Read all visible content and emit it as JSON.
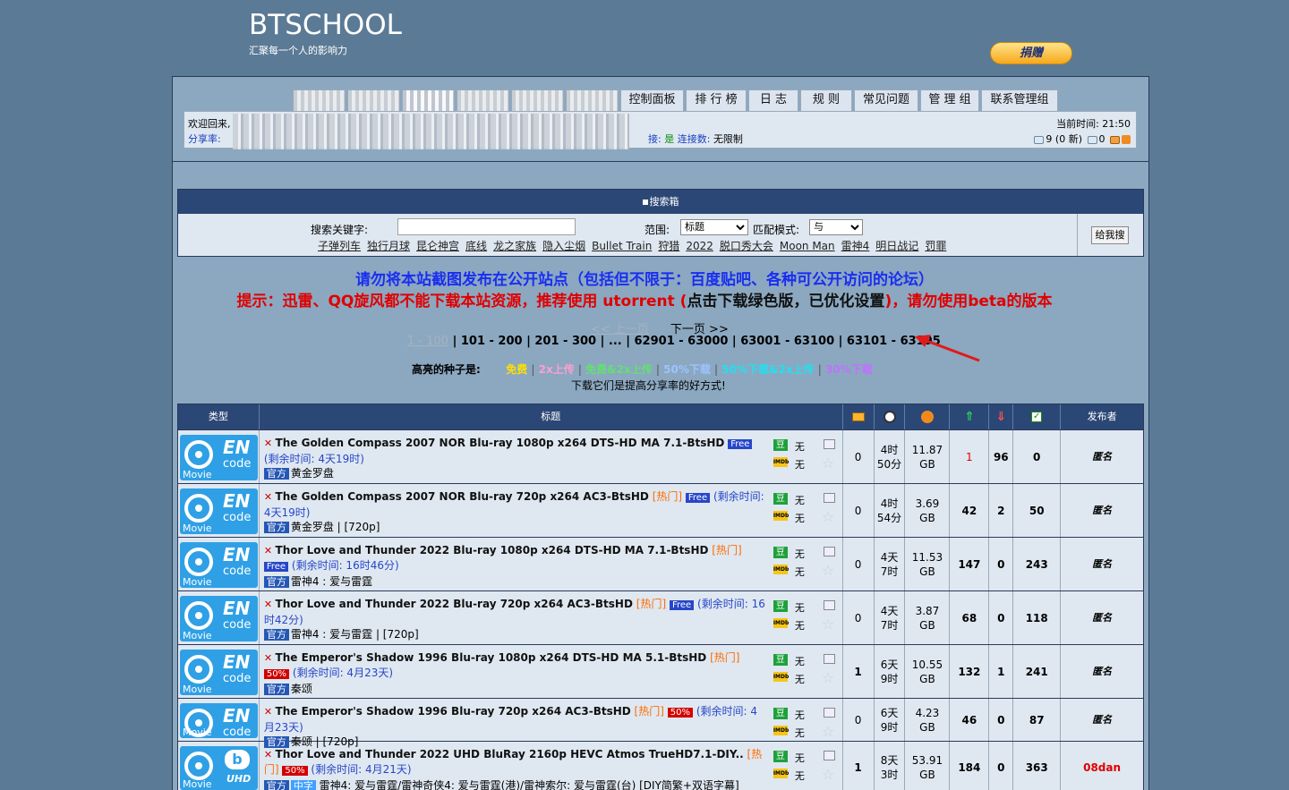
{
  "site": {
    "logo": "BTSCHOOL",
    "slogan": "汇聚每一个人的影响力",
    "donate": "捐赠"
  },
  "nav": {
    "blurred_tab_count": 6,
    "tabs": [
      "控制面板",
      "排 行 榜",
      "日 志",
      "规 则",
      "常见问题",
      "管 理 组",
      "联系管理组"
    ]
  },
  "userbar": {
    "welcome": "欢迎回来,",
    "share_ratio": "分享率:",
    "connect_label": "接:",
    "connect_yes": "是",
    "connections": "连接数:",
    "connections_val": "无限制",
    "time_label": "当前时间:",
    "time": "21:50",
    "messages": "9 (0 新)",
    "unread": "0"
  },
  "search": {
    "header": "搜索箱",
    "keyword_label": "搜索关键字:",
    "keyword_value": "",
    "scope_label": "范围:",
    "scope_value": "标题",
    "mode_label": "匹配模式:",
    "mode_value": "与",
    "button": "给我搜",
    "hot": [
      "子弹列车",
      "独行月球",
      "昆仑神宫",
      "底线",
      "龙之家族",
      "隐入尘烟",
      "Bullet Train",
      "狩猎",
      "2022",
      "脱口秀大会",
      "Moon Man",
      "雷神4",
      "明日战记",
      "罚罪"
    ]
  },
  "notices": {
    "line1": "请勿将本站截图发布在公开站点（包括但不限于：百度贴吧、各种可公开访问的论坛）",
    "line2a": "提示：迅雷、QQ旋风都不能下载本站资源，推荐使用 utorrent (",
    "line2b": "点击下载绿色版，已优化设置",
    "line2c": ")，请勿使用beta的版本"
  },
  "pager": {
    "prev": "<< 上一页",
    "next": "下一页 >>",
    "current": "1 - 100",
    "pages": "| 101 - 200 | 201 - 300 | ... | 62901 - 63000 | 63001 - 63100 | 63101 - 63195"
  },
  "legend": {
    "label": "高亮的种子是:",
    "items": [
      "免费",
      "2x上传",
      "免费&2x上传",
      "50%下载",
      "50%下载&2x上传",
      "30%下载"
    ],
    "tip": "下载它们是提高分享率的好方式!"
  },
  "columns": {
    "type": "类型",
    "title": "标题",
    "uploader": "发布者"
  },
  "badges": {
    "douban": "豆",
    "imdb": "IMDb",
    "none": "无",
    "official": "官方",
    "chinese": "中字",
    "hot": "热门",
    "free": "Free",
    "half": "50%"
  },
  "torrents": [
    {
      "cat": "encode",
      "name": "The Golden Compass 2007 NOR Blu-ray 1080p x264 DTS-HD MA 7.1-BtsHD",
      "hot": false,
      "promo": "Free",
      "remain": "(剩余时间: 4天19时)",
      "sub": "黄金罗盘",
      "comments": "0",
      "time": "4时\n50分",
      "size": "11.87\nGB",
      "seeders": "1",
      "leechers": "96",
      "done": "0",
      "uploader": "匿名",
      "seed_red": true
    },
    {
      "cat": "encode",
      "name": "The Golden Compass 2007 NOR Blu-ray 720p x264 AC3-BtsHD",
      "hot": true,
      "promo": "Free",
      "remain": "(剩余时间: 4天19时)",
      "sub": "黄金罗盘 | [720p]",
      "comments": "0",
      "time": "4时\n54分",
      "size": "3.69\nGB",
      "seeders": "42",
      "leechers": "2",
      "done": "50",
      "uploader": "匿名",
      "seed_red": false
    },
    {
      "cat": "encode",
      "name": "Thor Love and Thunder 2022 Blu-ray 1080p x264 DTS-HD MA 7.1-BtsHD",
      "hot": true,
      "promo": "Free",
      "remain": "(剩余时间: 16时46分)",
      "sub": "雷神4 : 爱与雷霆",
      "comments": "0",
      "time": "4天\n7时",
      "size": "11.53\nGB",
      "seeders": "147",
      "leechers": "0",
      "done": "243",
      "uploader": "匿名",
      "seed_red": false
    },
    {
      "cat": "encode",
      "name": "Thor Love and Thunder 2022 Blu-ray 720p x264 AC3-BtsHD",
      "hot": true,
      "promo": "Free",
      "remain": "(剩余时间: 16时42分)",
      "sub": "雷神4 : 爱与雷霆 | [720p]",
      "comments": "0",
      "time": "4天\n7时",
      "size": "3.87\nGB",
      "seeders": "68",
      "leechers": "0",
      "done": "118",
      "uploader": "匿名",
      "seed_red": false
    },
    {
      "cat": "encode",
      "name": "The Emperor's Shadow 1996 Blu-ray 1080p x264 DTS-HD MA 5.1-BtsHD",
      "hot": true,
      "promo": "50%",
      "remain": "(剩余时间: 4月23天)",
      "sub": "秦颂",
      "comments": "1",
      "time": "6天\n9时",
      "size": "10.55\nGB",
      "seeders": "132",
      "leechers": "1",
      "done": "241",
      "uploader": "匿名",
      "seed_red": false
    },
    {
      "cat": "encode",
      "name": "The Emperor's Shadow 1996 Blu-ray 720p x264 AC3-BtsHD",
      "hot": true,
      "promo": "50%",
      "remain": "(剩余时间: 4月23天)",
      "sub": "秦颂 | [720p]",
      "comments": "0",
      "time": "6天\n9时",
      "size": "4.23\nGB",
      "seeders": "46",
      "leechers": "0",
      "done": "87",
      "uploader": "匿名",
      "seed_red": false
    },
    {
      "cat": "uhd",
      "name": "Thor Love and Thunder 2022 UHD BluRay 2160p HEVC Atmos TrueHD7.1-DIY..",
      "hot": true,
      "promo": "50%",
      "remain": "(剩余时间: 4月21天)",
      "sub": "雷神4: 爱与雷霆/雷神奇侠4: 爱与雷霆(港)/雷神索尔: 爱与雷霆(台) [DIY简繁+双语字幕]",
      "chinese": true,
      "comments": "1",
      "time": "8天\n3时",
      "size": "53.91\nGB",
      "seeders": "184",
      "leechers": "0",
      "done": "363",
      "uploader": "08dan",
      "seed_red": false
    }
  ],
  "colors": {
    "background": "#5b7a95",
    "header_blue": "#2b4776",
    "panel": "#dfe8f1",
    "notice_blue": "#1a2ef0",
    "notice_red": "#e00000"
  }
}
